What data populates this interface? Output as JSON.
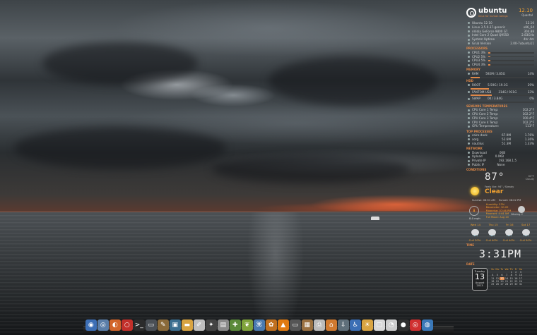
{
  "conky": {
    "logo": {
      "name": "ubuntu",
      "tagline": "linux for human beings",
      "version": "12.10",
      "codename": "Quantal"
    },
    "system": [
      {
        "label": "Ubuntu 12.10",
        "value": "12.10"
      },
      {
        "label": "Linux 3.5.0-37-generic",
        "value": "x86_64"
      },
      {
        "label": "nVidia GeForce 9800 GT",
        "value": "304.88"
      },
      {
        "label": "Intel Core 2 Quad Q9550",
        "value": "2.83GHz"
      },
      {
        "label": "System Uptime",
        "value": "4hr 4m"
      },
      {
        "label": "Grub Version",
        "value": "2.00-7ubuntu11"
      }
    ],
    "processors_title": "PROCESSORS",
    "cpus": [
      {
        "label": "CPU1 3%",
        "level": 0.03
      },
      {
        "label": "CPU2 5%",
        "level": 0.05
      },
      {
        "label": "CPU3 5%",
        "level": 0.05
      },
      {
        "label": "CPU4 3%",
        "level": 0.03
      }
    ],
    "memory_title": "MEMORY",
    "ram": {
      "label": "RAM",
      "used": "592M",
      "total": "3.85G",
      "percent": "14%",
      "level": 0.14
    },
    "hdd_title": "HDD",
    "disks": [
      {
        "label": "ROOT",
        "used": "5.59G",
        "total": "19.1G",
        "percent": "29%",
        "level": 0.29
      },
      {
        "label": "FANTOM USB",
        "used": "314G",
        "total": "931G",
        "percent": "33%",
        "level": 0.33
      },
      {
        "label": "SWAP",
        "used": "0K",
        "total": "3.84G",
        "percent": "0%",
        "level": 0.0
      }
    ],
    "temps_title": "SENSORS TEMPERATURES",
    "temps": [
      {
        "label": "CPU Core 1 Temp:",
        "value": "102.2°F"
      },
      {
        "label": "CPU Core 2 Temp:",
        "value": "102.2°F"
      },
      {
        "label": "CPU Core 3 Temp:",
        "value": "100.4°F"
      },
      {
        "label": "CPU Core 4 Temp:",
        "value": "102.2°F"
      },
      {
        "label": "GPU Temperature:",
        "value": "113°F"
      }
    ],
    "processes_title": "TOP PROCESSES",
    "processes": [
      {
        "name": "cairo-dock",
        "mem": "67.9M",
        "cpu": "1.76%"
      },
      {
        "name": "xorg",
        "mem": "52.6M",
        "cpu": "1.36%"
      },
      {
        "name": "nautilus",
        "mem": "51.3M",
        "cpu": "1.33%"
      }
    ],
    "network_title": "NETWORK",
    "network": [
      {
        "label": "Download",
        "value": "0KB"
      },
      {
        "label": "Upload",
        "value": "0.0KB"
      },
      {
        "label": "Private IP",
        "value": "192.168.1.5"
      },
      {
        "label": "Public IP",
        "value": "None"
      }
    ],
    "conditions_title": "CONDITIONS",
    "weather": {
      "temp": "87°",
      "feels": "Feels like: 94° / Steady",
      "meta_top": "62°F",
      "meta_bottom": "Cloudy",
      "condition": "Clear",
      "sunrise": "Sunrise: 06:51 AM",
      "sunset": "Sunset: 08:02 PM",
      "wind_speed": "8.0 mph",
      "humidity": "Humidity: 53%",
      "barometer": "Barometer: 30.09",
      "moonrise": "Moonrise: 07:46 PM",
      "moonset": "Moonset: 4:44 AM",
      "full_moon": "Full Moon: Aug 20",
      "moon_phase": "Waxing C",
      "forecast_days": [
        "Wed 14",
        "Thu 15",
        "Fri 16",
        "Sat 17"
      ],
      "forecast_vals": [
        "Cull 20%",
        "Cull 40%",
        "Cull 40%",
        "Cull 50%"
      ]
    },
    "time_title": "TIME",
    "time": "3:31PM",
    "date_title": "DATE",
    "date": {
      "weekday": "Tuesday",
      "day": "13",
      "month": "August",
      "year": "2013",
      "cal_head": [
        "Su",
        "Mo",
        "Tu",
        "We",
        "Th",
        "Fr",
        "Sa"
      ],
      "cal_rows": [
        [
          "",
          "",
          "",
          "",
          "1",
          "2",
          "3"
        ],
        [
          "4",
          "5",
          "6",
          "7",
          "8",
          "9",
          "10"
        ],
        [
          "11",
          "12",
          "13",
          "14",
          "15",
          "16",
          "17"
        ],
        [
          "18",
          "19",
          "20",
          "21",
          "22",
          "23",
          "24"
        ],
        [
          "25",
          "26",
          "27",
          "28",
          "29",
          "30",
          "31"
        ]
      ],
      "today": "13"
    }
  },
  "dock": {
    "items": [
      {
        "name": "globe-icon",
        "glyph": "◉",
        "color": "#3d6fb5"
      },
      {
        "name": "web-browser-icon",
        "glyph": "◎",
        "color": "#5b7ea8"
      },
      {
        "name": "firefox-icon",
        "glyph": "◐",
        "color": "#d2652a"
      },
      {
        "name": "opera-icon",
        "glyph": "○",
        "color": "#c3302a"
      },
      {
        "name": "terminal-icon",
        "glyph": ">_",
        "color": "#2b2b2b"
      },
      {
        "name": "monitor-icon",
        "glyph": "▭",
        "color": "#4a4f55"
      },
      {
        "name": "gimp-icon",
        "glyph": "✎",
        "color": "#8a6a3a"
      },
      {
        "name": "image-viewer-icon",
        "glyph": "▣",
        "color": "#3b6e8f"
      },
      {
        "name": "folder-icon",
        "glyph": "▬",
        "color": "#d9a441"
      },
      {
        "name": "text-editor-icon",
        "glyph": "✐",
        "color": "#bfbfbf"
      },
      {
        "name": "inkscape-icon",
        "glyph": "✦",
        "color": "#444"
      },
      {
        "name": "files-icon",
        "glyph": "▤",
        "color": "#8a8a8a"
      },
      {
        "name": "bookmark-icon",
        "glyph": "✚",
        "color": "#5a8a3a"
      },
      {
        "name": "leaf-icon",
        "glyph": "❦",
        "color": "#7fa33a"
      },
      {
        "name": "network-icon",
        "glyph": "⌘",
        "color": "#4a7ab0"
      },
      {
        "name": "transmission-icon",
        "glyph": "✿",
        "color": "#c07020"
      },
      {
        "name": "vlc-icon",
        "glyph": "▲",
        "color": "#e07a10"
      },
      {
        "name": "monitor2-icon",
        "glyph": "▭",
        "color": "#555"
      },
      {
        "name": "archive-icon",
        "glyph": "▦",
        "color": "#9a7040"
      },
      {
        "name": "printer-icon",
        "glyph": "⎙",
        "color": "#bbb"
      },
      {
        "name": "home-folder-icon",
        "glyph": "⌂",
        "color": "#d07a30"
      },
      {
        "name": "downloads-icon",
        "glyph": "⇩",
        "color": "#5f6f7a"
      },
      {
        "name": "accessibility-icon",
        "glyph": "♿",
        "color": "#3b6fb5"
      },
      {
        "name": "weather-icon",
        "glyph": "☀",
        "color": "#d9a441"
      },
      {
        "name": "window-icon",
        "glyph": "▢",
        "color": "#d8d8d8"
      },
      {
        "name": "eyes-icon",
        "glyph": "◔",
        "color": "#ccc"
      },
      {
        "name": "recorder-icon",
        "glyph": "●",
        "color": "#303030"
      },
      {
        "name": "lifebuoy-icon",
        "glyph": "◎",
        "color": "#d03030"
      },
      {
        "name": "earth-icon",
        "glyph": "◍",
        "color": "#3a78b8"
      }
    ]
  }
}
